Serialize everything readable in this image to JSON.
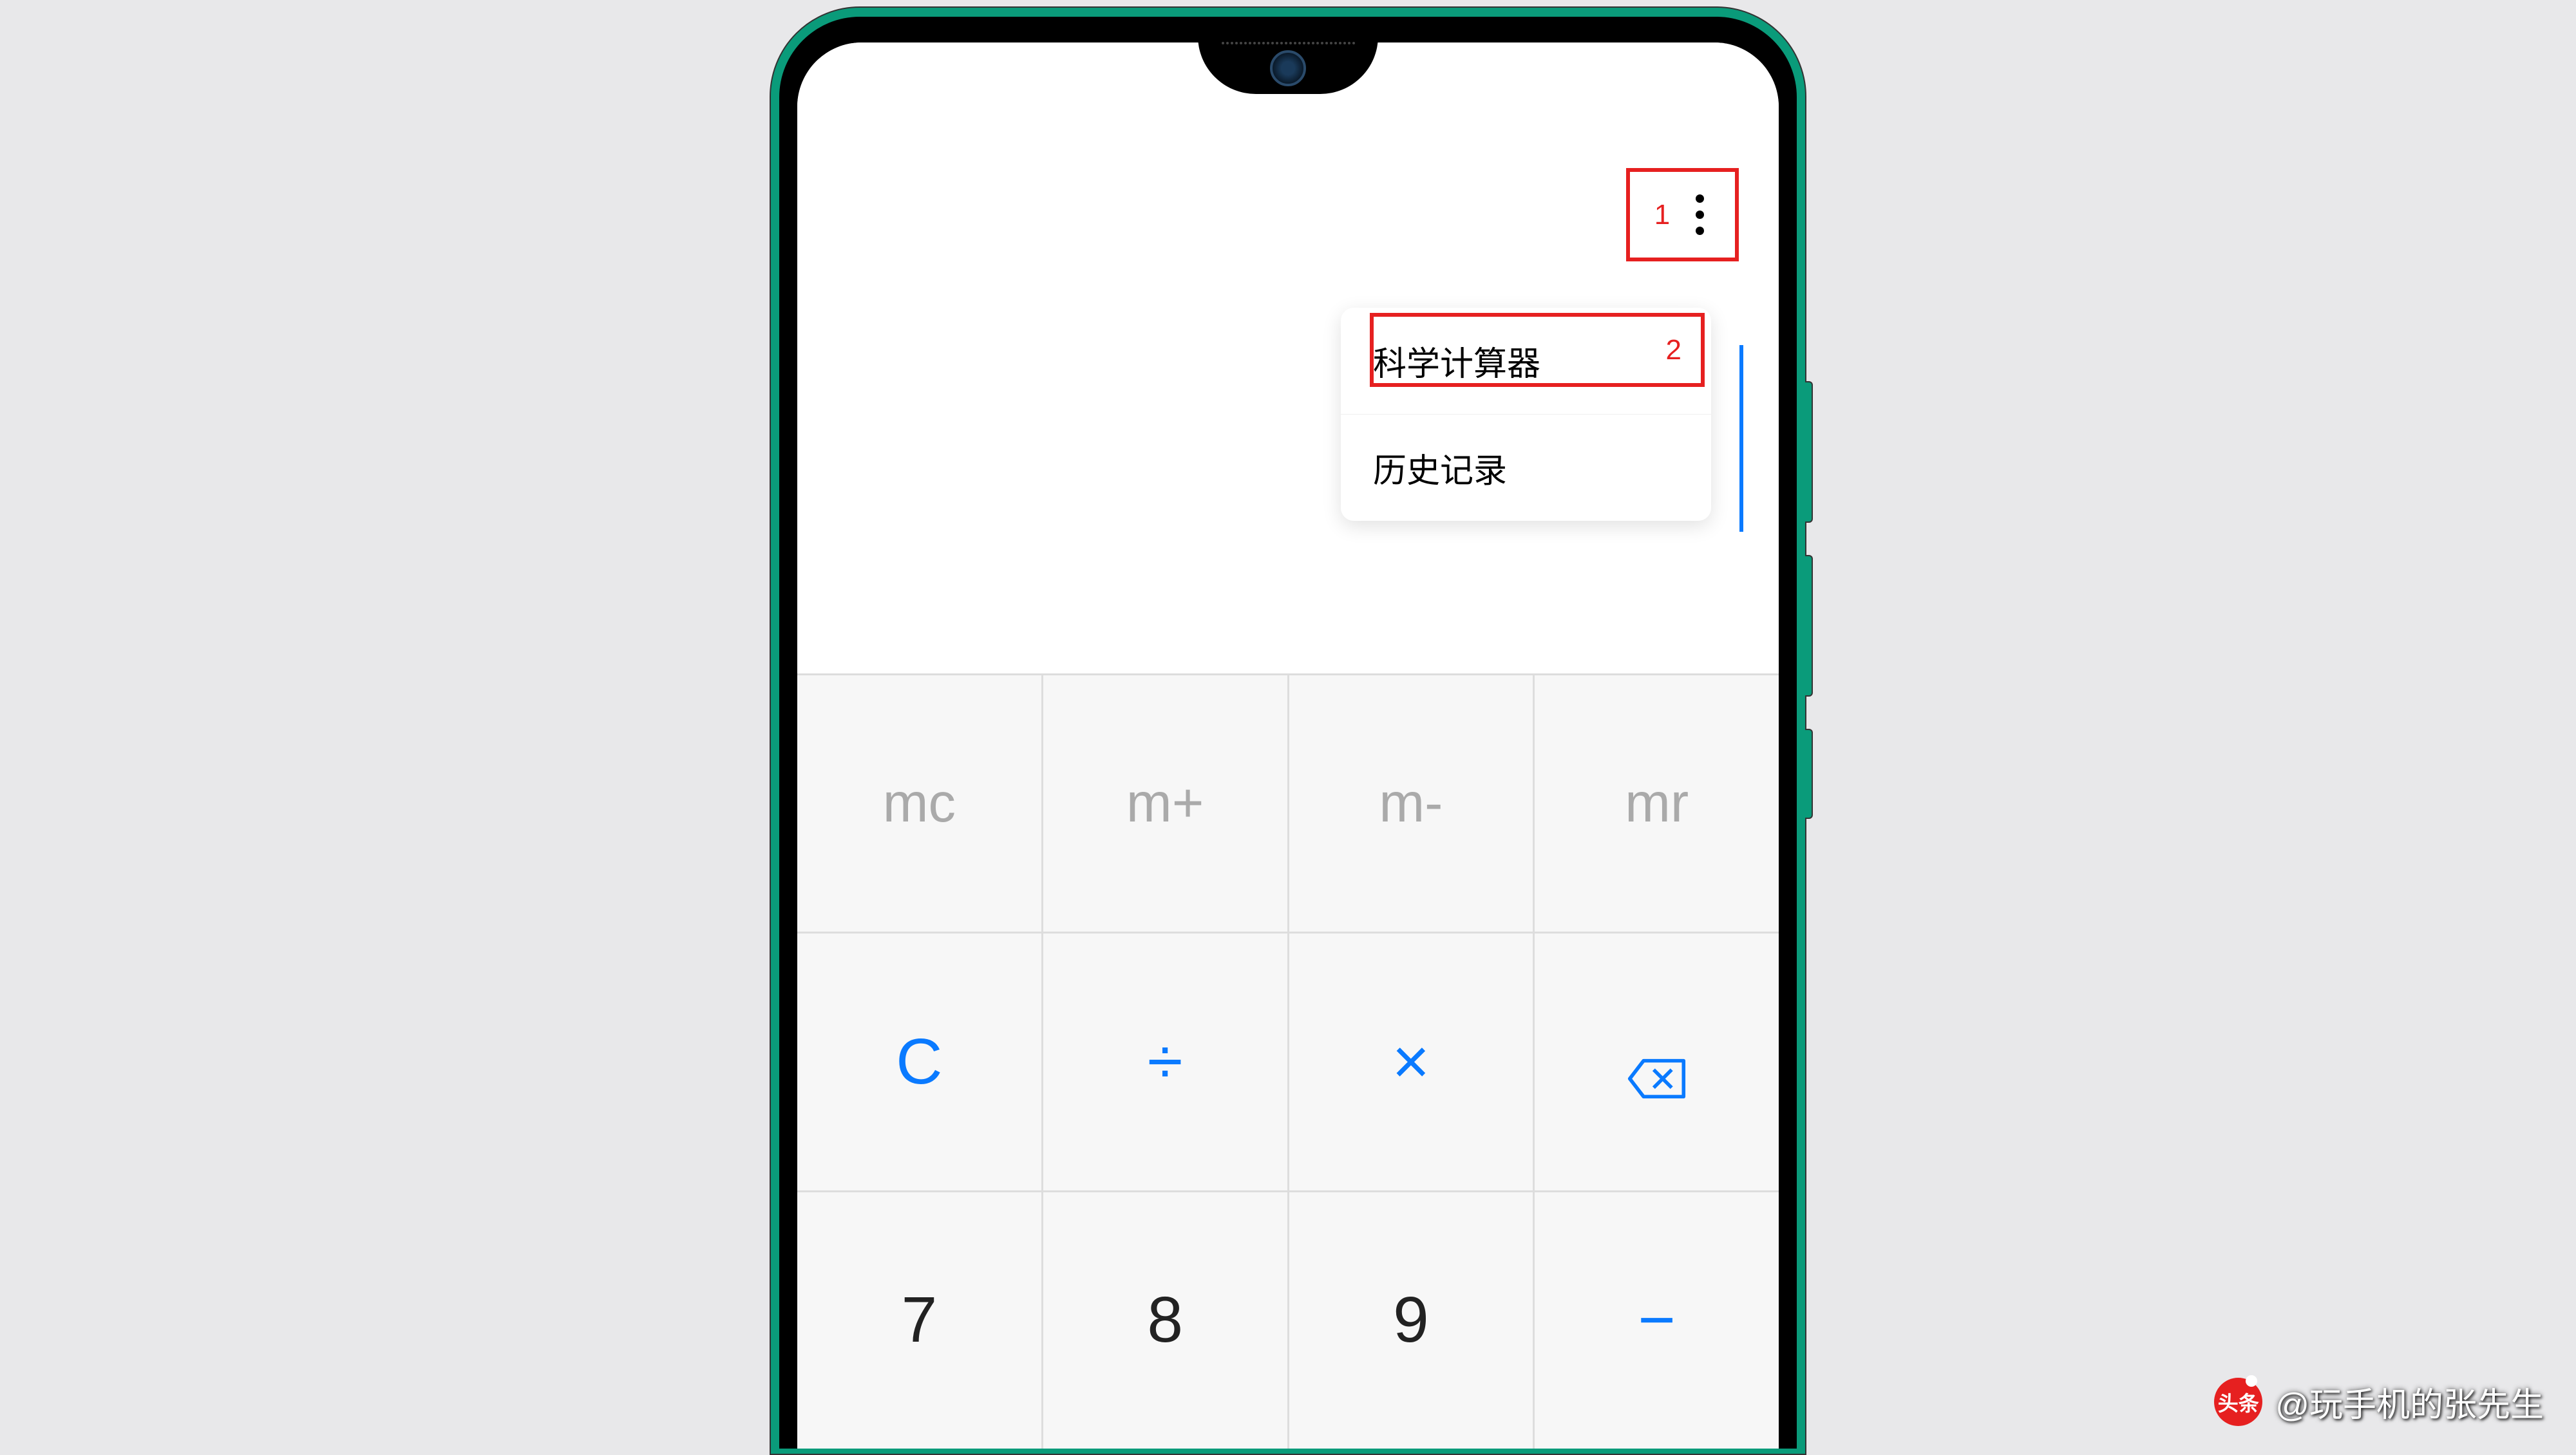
{
  "callouts": {
    "more_button": "1",
    "scientific_calc": "2"
  },
  "menu": {
    "scientific_calculator": "科学计算器",
    "history": "历史记录"
  },
  "keypad": {
    "memory": {
      "mc": "mc",
      "mplus": "m+",
      "mminus": "m-",
      "mr": "mr"
    },
    "operators": {
      "clear": "C",
      "divide": "÷",
      "multiply": "×",
      "minus": "−"
    },
    "digits": {
      "seven": "7",
      "eight": "8",
      "nine": "9"
    }
  },
  "watermark": {
    "logo": "头条",
    "text": "@玩手机的张先生"
  }
}
